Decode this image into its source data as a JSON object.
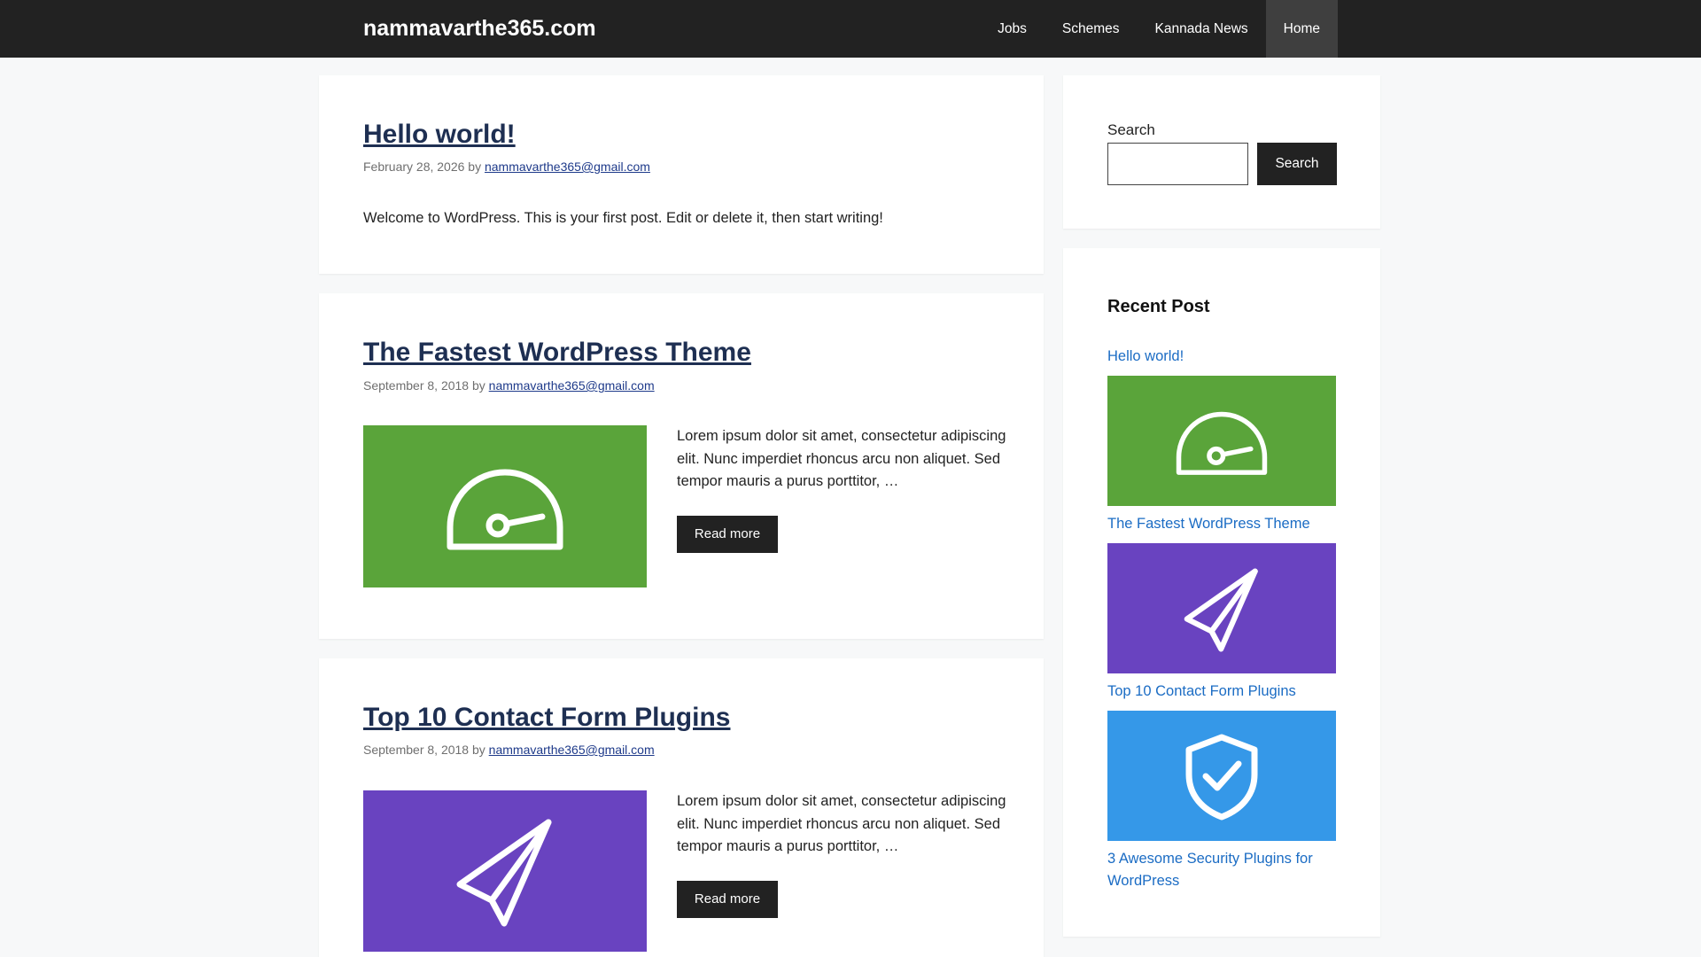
{
  "header": {
    "site_title": "nammavarthe365.com",
    "nav": [
      {
        "label": "Jobs"
      },
      {
        "label": "Schemes"
      },
      {
        "label": "Kannada News"
      },
      {
        "label": "Home"
      }
    ]
  },
  "posts": [
    {
      "title": "Hello world!",
      "date": "February 28, 2026",
      "by": "by",
      "author": "nammavarthe365@gmail.com",
      "content": "Welcome to WordPress. This is your first post. Edit or delete it, then start writing!"
    },
    {
      "title": "The Fastest WordPress Theme",
      "date": "September 8, 2018",
      "by": "by",
      "author": "nammavarthe365@gmail.com",
      "excerpt": "Lorem ipsum dolor sit amet, consectetur adipiscing elit. Nunc imperdiet rhoncus arcu non aliquet. Sed tempor mauris a purus porttitor, …",
      "read_more": "Read more",
      "thumb_color": "#5aa43a",
      "thumb_icon": "speedometer-icon"
    },
    {
      "title": "Top 10 Contact Form Plugins",
      "date": "September 8, 2018",
      "by": "by",
      "author": "nammavarthe365@gmail.com",
      "excerpt": "Lorem ipsum dolor sit amet, consectetur adipiscing elit. Nunc imperdiet rhoncus arcu non aliquet. Sed tempor mauris a purus porttitor, …",
      "read_more": "Read more",
      "thumb_color": "#6943c0",
      "thumb_icon": "paper-plane-icon"
    }
  ],
  "sidebar": {
    "search": {
      "label": "Search",
      "value": "",
      "button": "Search"
    },
    "recent": {
      "title": "Recent Post",
      "items": [
        {
          "label": "Hello world!"
        },
        {
          "label": "The Fastest WordPress Theme",
          "thumb_color": "#5aa43a",
          "thumb_icon": "speedometer-icon"
        },
        {
          "label": "Top 10 Contact Form Plugins",
          "thumb_color": "#6943c0",
          "thumb_icon": "paper-plane-icon"
        },
        {
          "label": "3 Awesome Security Plugins for WordPress",
          "thumb_color": "#3598e8",
          "thumb_icon": "shield-check-icon"
        }
      ]
    }
  },
  "colors": {
    "header_bg": "#222222",
    "title": "#1e2f52",
    "link": "#1b6cc4",
    "button": "#222222"
  }
}
